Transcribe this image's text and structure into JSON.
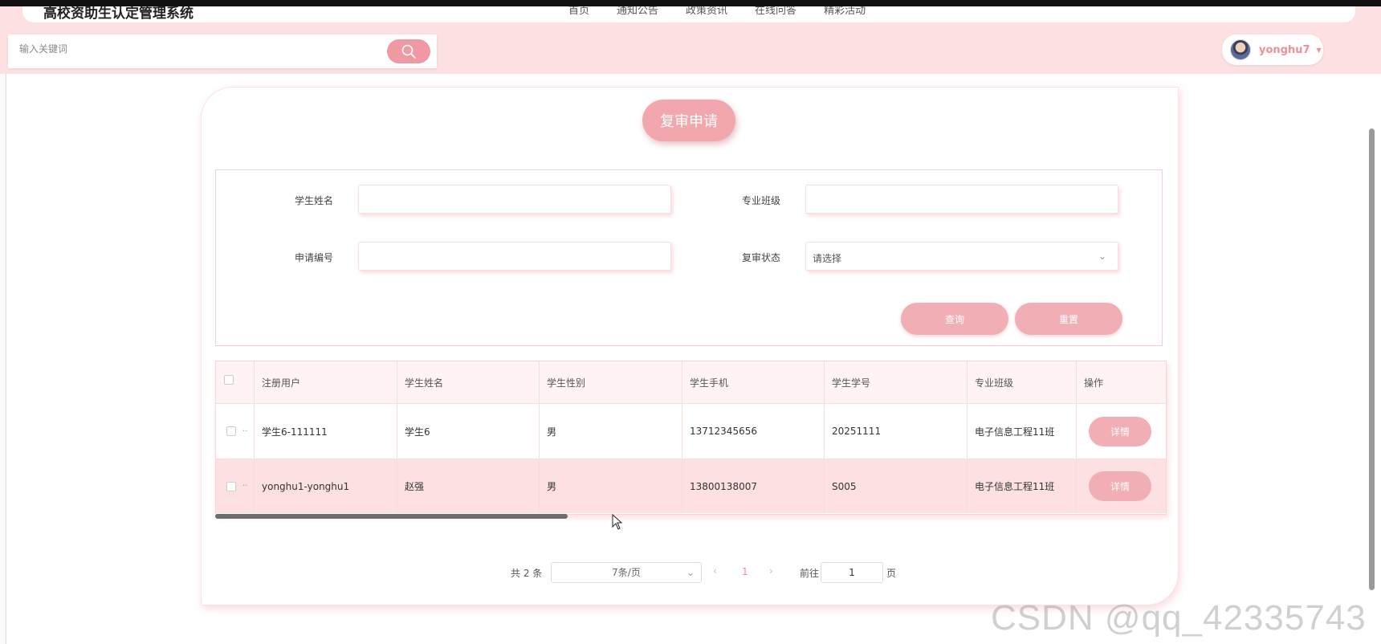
{
  "header": {
    "site_title": "高校资助生认定管理系统",
    "nav": [
      "首页",
      "通知公告",
      "政策资讯",
      "在线问答",
      "精彩活动"
    ],
    "search": {
      "placeholder": "输入关键词"
    },
    "user": {
      "name": "yonghu7"
    }
  },
  "page": {
    "title": "复审申请"
  },
  "form": {
    "student_name_label": "学生姓名",
    "major_class_label": "专业班级",
    "apply_no_label": "申请编号",
    "review_status_label": "复审状态",
    "review_status_placeholder": "请选择",
    "query_label": "查询",
    "reset_label": "重置"
  },
  "table": {
    "columns": [
      "注册用户",
      "学生姓名",
      "学生性别",
      "学生手机",
      "学生学号",
      "专业班级",
      "操作"
    ],
    "rows": [
      {
        "user": "学生6-111111",
        "name": "学生6",
        "gender": "男",
        "phone": "13712345656",
        "student_no": "20251111",
        "class": "电子信息工程11班",
        "action": "详情"
      },
      {
        "user": "yonghu1-yonghu1",
        "name": "赵强",
        "gender": "男",
        "phone": "13800138007",
        "student_no": "S005",
        "class": "电子信息工程11班",
        "action": "详情"
      }
    ]
  },
  "pagination": {
    "total": "共 2 条",
    "page_size": "7条/页",
    "current": "1",
    "goto_label": "前往",
    "goto_value": "1",
    "unit": "页"
  },
  "watermark": "CSDN @qq_42335743",
  "colors": {
    "accent": "#f2aeb5",
    "header_bg": "#fde0e2",
    "highlight_row": "#fde0e2"
  }
}
